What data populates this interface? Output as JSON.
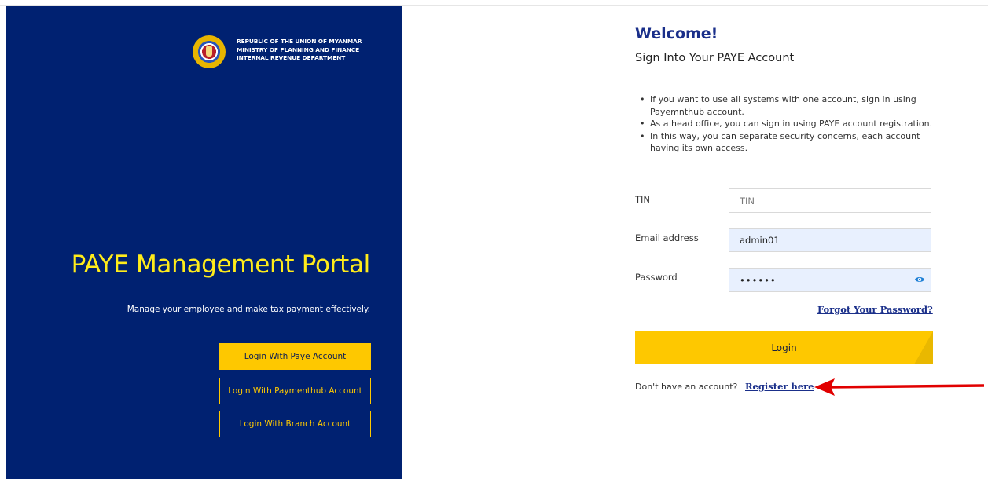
{
  "left": {
    "org_lines": [
      "REPUBLIC OF THE UNION OF MYANMAR",
      "MINISTRY OF PLANNING AND FINANCE",
      "INTERNAL REVENUE DEPARTMENT"
    ],
    "title": "PAYE Management Portal",
    "subtitle": "Manage your employee and make tax payment effectively.",
    "buttons": {
      "paye": "Login With Paye Account",
      "paymenthub": "Login With Paymenthub Account",
      "branch": "Login With Branch Account"
    }
  },
  "form": {
    "welcome": "Welcome!",
    "heading": "Sign Into Your PAYE Account",
    "bullets": [
      "If you want to use all systems with one account, sign in using Payemnthub account.",
      "As a head office, you can sign in using PAYE account registration.",
      "In this way, you can separate security concerns, each account having its own access."
    ],
    "tin": {
      "label": "TIN",
      "placeholder": "TIN",
      "value": ""
    },
    "email": {
      "label": "Email address",
      "value": "admin01"
    },
    "password": {
      "label": "Password",
      "value": "••••••"
    },
    "forgot": "Forgot Your Password?",
    "login": "Login",
    "no_account": "Don't have an account?",
    "register": "Register here"
  },
  "colors": {
    "panel": "#002171",
    "accent": "#fec800",
    "title": "#ffec1a",
    "link": "#1a2f8a",
    "arrow": "#e10000"
  },
  "icons": {
    "emblem": "government-emblem",
    "eye": "eye-icon",
    "arrow": "red-arrow-annotation"
  }
}
